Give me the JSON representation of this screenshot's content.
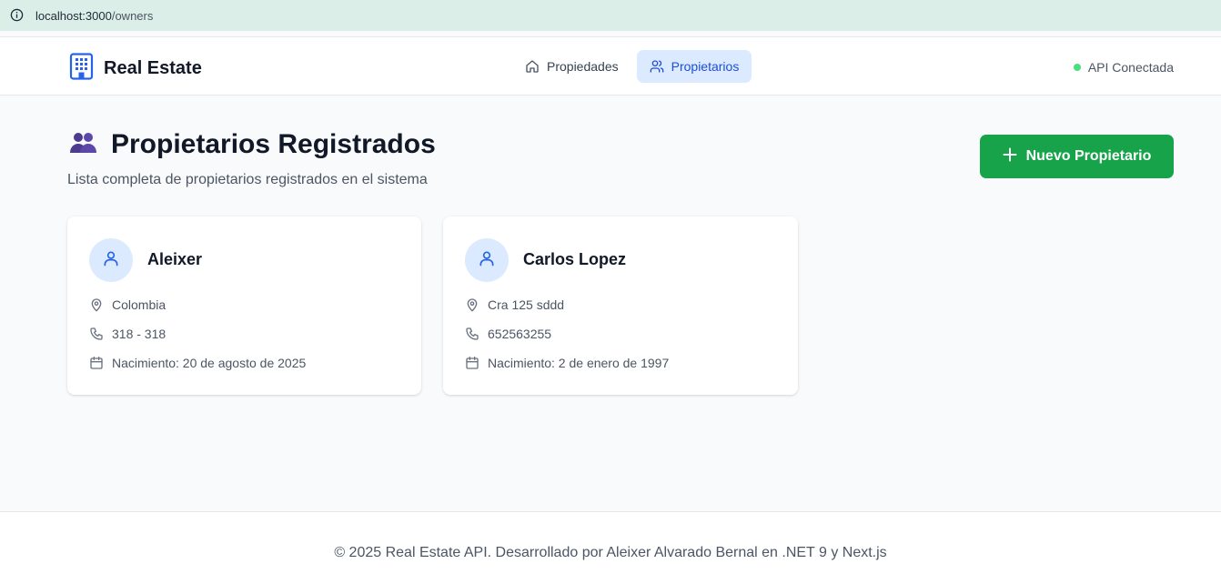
{
  "browser": {
    "url_host": "localhost:3000",
    "url_path": "/owners"
  },
  "header": {
    "brand_title": "Real Estate",
    "nav": [
      {
        "label": "Propiedades",
        "icon": "home-icon",
        "active": false
      },
      {
        "label": "Propietarios",
        "icon": "users-icon",
        "active": true
      }
    ],
    "api_status": "API Conectada",
    "api_status_color": "#4ade80"
  },
  "page": {
    "title": "Propietarios Registrados",
    "subtitle": "Lista completa de propietarios registrados en el sistema",
    "new_button_label": "Nuevo Propietario"
  },
  "owners": [
    {
      "name": "Aleixer",
      "address": "Colombia",
      "phone": "318 - 318",
      "birth": "Nacimiento: 20 de agosto de 2025"
    },
    {
      "name": "Carlos Lopez",
      "address": "Cra 125 sddd",
      "phone": "652563255",
      "birth": "Nacimiento: 2 de enero de 1997"
    }
  ],
  "footer": {
    "text": "© 2025 Real Estate API. Desarrollado por Aleixer Alvarado Bernal en .NET 9 y Next.js"
  },
  "colors": {
    "accent": "#1d4ed8",
    "success": "#16a34a",
    "background": "#f9fafb"
  }
}
